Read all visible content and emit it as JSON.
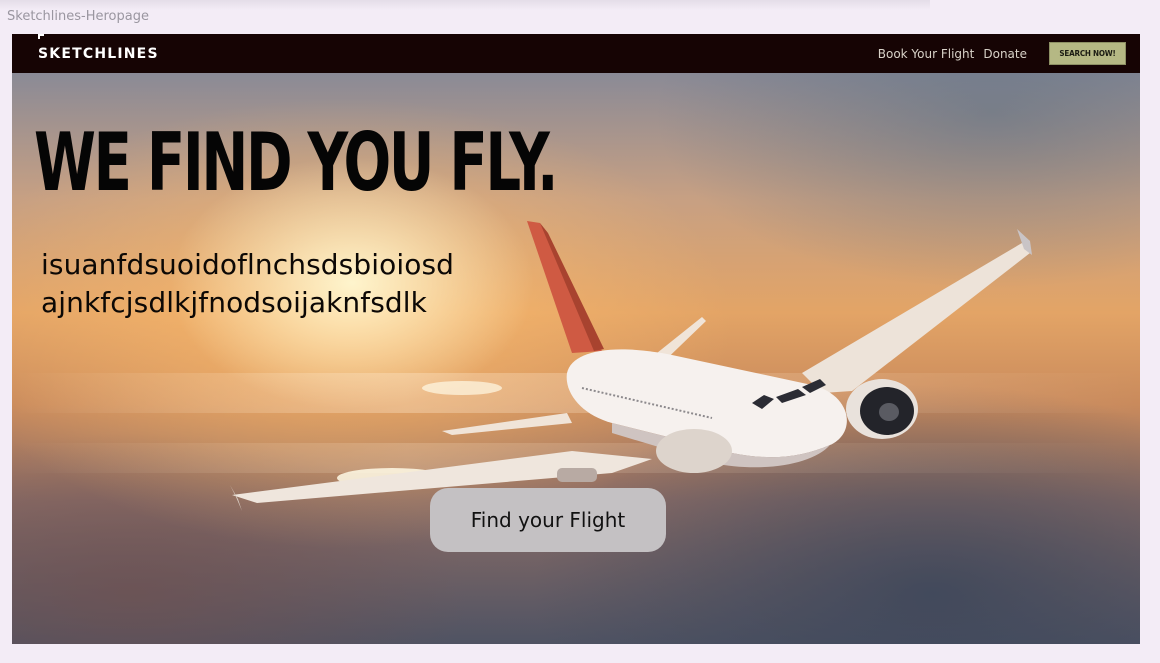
{
  "window": {
    "frame_label": "Sketchlines-Heropage"
  },
  "navbar": {
    "logo": "SKETCHLINES",
    "links": [
      "Book Your Flight",
      "Donate"
    ],
    "search_label": "SEARCH NOW!"
  },
  "hero": {
    "headline": "WE FIND YOU FLY.",
    "subtext": "isuanfdsuoidoflnchsdsbioiosdajnkfcjsdlkjfnodsoijaknfsdlk",
    "cta_label": "Find your Flight"
  },
  "colors": {
    "navbar_bg": "#160404",
    "search_button_bg": "#b5b884",
    "cta_bg": "#c4c1c3",
    "headline": "#050505",
    "canvas_bg": "#f3ecf6"
  }
}
